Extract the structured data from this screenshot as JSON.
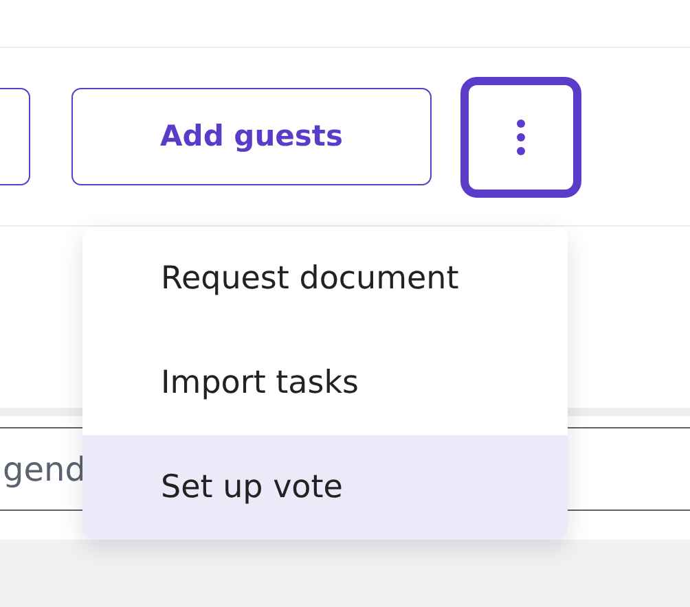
{
  "toolbar": {
    "buttons": [
      {
        "kind": "outline"
      },
      {
        "kind": "outline",
        "label": "Add guests"
      },
      {
        "kind": "more",
        "focused": true
      }
    ]
  },
  "agenda_field": {
    "value": "gend"
  },
  "menu": {
    "items": [
      {
        "label": "Request document",
        "selected": false
      },
      {
        "label": "Import tasks",
        "selected": false
      },
      {
        "label": "Set up vote",
        "selected": true
      }
    ]
  }
}
